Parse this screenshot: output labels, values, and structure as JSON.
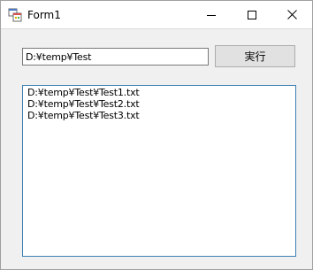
{
  "window": {
    "title": "Form1",
    "icon": "winforms-app-icon",
    "controls": {
      "minimize_icon": "minimize-icon",
      "maximize_icon": "maximize-icon",
      "close_icon": "close-icon"
    }
  },
  "form": {
    "path_value": "D:¥temp¥Test",
    "run_button_label": "実行",
    "file_list": [
      "D:¥temp¥Test¥Test1.txt",
      "D:¥temp¥Test¥Test2.txt",
      "D:¥temp¥Test¥Test3.txt"
    ]
  },
  "colors": {
    "list_border": "#3c7fb1",
    "button_face": "#e1e1e1",
    "window_bg": "#f0f0f0"
  }
}
